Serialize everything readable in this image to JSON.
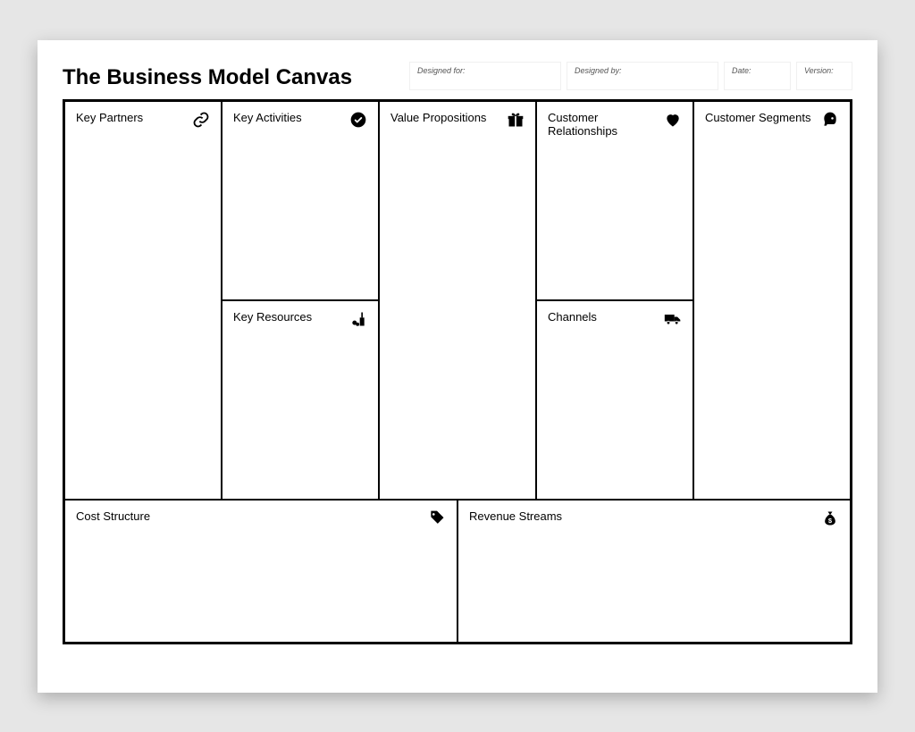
{
  "title": "The Business Model Canvas",
  "meta": {
    "designed_for_label": "Designed for:",
    "designed_by_label": "Designed by:",
    "date_label": "Date:",
    "version_label": "Version:"
  },
  "cells": {
    "key_partners": "Key Partners",
    "key_activities": "Key Activities",
    "key_resources": "Key Resources",
    "value_propositions": "Value Propositions",
    "customer_relationships": "Customer Relationships",
    "channels": "Channels",
    "customer_segments": "Customer Segments",
    "cost_structure": "Cost Structure",
    "revenue_streams": "Revenue Streams"
  }
}
